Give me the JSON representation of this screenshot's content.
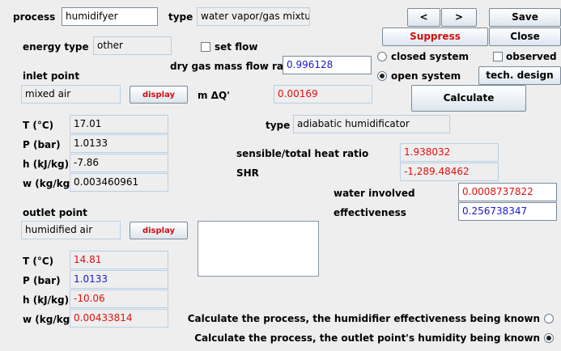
{
  "process": {
    "label": "process",
    "value": "humidifyer"
  },
  "type": {
    "label": "type",
    "value": "water vapor/gas mixtures"
  },
  "nav": {
    "prev": "<",
    "next": ">"
  },
  "buttons": {
    "save": "Save",
    "suppress": "Suppress",
    "close": "Close",
    "tech_design": "tech. design",
    "calculate": "Calculate",
    "display_inlet": "display",
    "display_outlet": "display"
  },
  "energy_type": {
    "label": "energy type",
    "value": "other"
  },
  "set_flow": {
    "label": "set flow",
    "checked": false
  },
  "dry_gas_flow": {
    "label": "dry gas mass flow rate",
    "value": "0.996128"
  },
  "system": {
    "closed": "closed system",
    "open": "open system",
    "selected": "open"
  },
  "observed": {
    "label": "observed",
    "checked": false
  },
  "inlet": {
    "title": "inlet point",
    "name": "mixed air",
    "T_label": "T (°C)",
    "T": "17.01",
    "P_label": "P (bar)",
    "P": "1.0133",
    "h_label": "h (kJ/kg)",
    "h": "-7.86",
    "w_label": "w (kg/kg)",
    "w": "0.003460961"
  },
  "mdq": {
    "label": "m ΔQ'",
    "value": "0.00169"
  },
  "type2": {
    "label": "type",
    "value": "adiabatic humidificator"
  },
  "heat_ratio": {
    "label": "sensible/total heat ratio",
    "value": "1.938032"
  },
  "shr": {
    "label": "SHR",
    "value": "-1,289.48462"
  },
  "water_involved": {
    "label": "water involved",
    "value": "0.0008737822"
  },
  "effectiveness": {
    "label": "effectiveness",
    "value": "0.256738347"
  },
  "outlet": {
    "title": "outlet point",
    "name": "humidified air",
    "T_label": "T (°C)",
    "T": "14.81",
    "P_label": "P (bar)",
    "P": "1.0133",
    "h_label": "h (kJ/kg)",
    "h": "-10.06",
    "w_label": "w (kg/kg)",
    "w": "0.00433814"
  },
  "calc_mode": {
    "option1": "Calculate the process, the humidifier effectiveness being known",
    "option2": "Calculate the process, the outlet point's humidity being known",
    "selected": "option2"
  }
}
